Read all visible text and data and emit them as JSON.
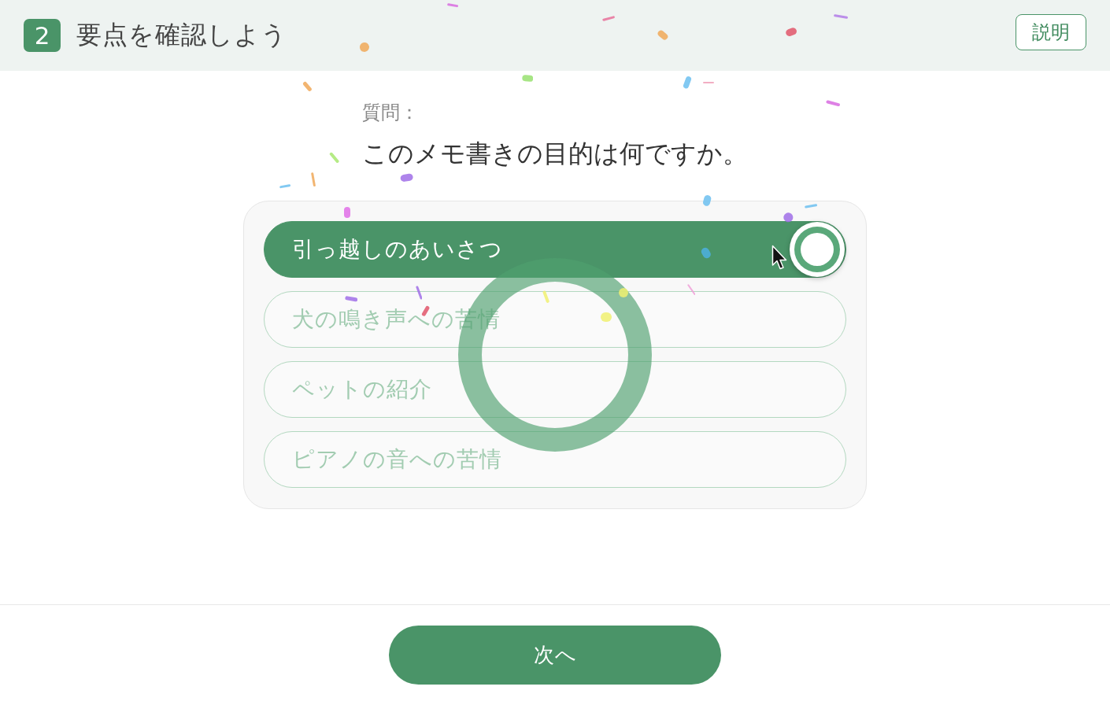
{
  "header": {
    "step": "2",
    "title": "要点を確認しよう",
    "help_button": "説明"
  },
  "question": {
    "label": "質問：",
    "text": "このメモ書きの目的は何ですか。"
  },
  "options": [
    {
      "label": "引っ越しのあいさつ",
      "selected": true,
      "disabled": false
    },
    {
      "label": "犬の鳴き声への苦情",
      "selected": false,
      "disabled": true
    },
    {
      "label": "ペットの紹介",
      "selected": false,
      "disabled": true
    },
    {
      "label": "ピアノの音への苦情",
      "selected": false,
      "disabled": true
    }
  ],
  "feedback": {
    "kind": "correct"
  },
  "footer": {
    "next_button": "次へ"
  }
}
